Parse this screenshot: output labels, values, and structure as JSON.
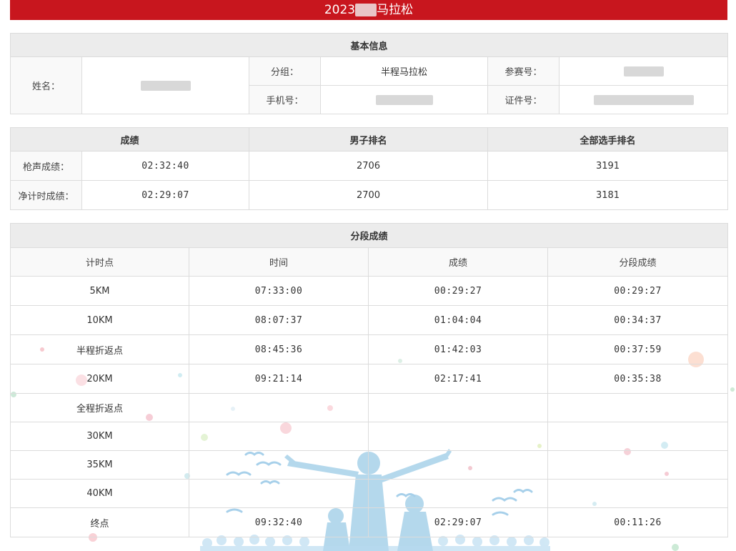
{
  "header": {
    "title_prefix": "2023",
    "title_suffix": "马拉松"
  },
  "basic": {
    "section_title": "基本信息",
    "name_label": "姓名：",
    "group_label": "分组：",
    "group_value": "半程马拉松",
    "bib_label": "参赛号：",
    "phone_label": "手机号：",
    "id_label": "证件号："
  },
  "results": {
    "headers": [
      "成绩",
      "男子排名",
      "全部选手排名"
    ],
    "gun": {
      "label": "枪声成绩：",
      "time": "02:32:40",
      "male_rank": "2706",
      "overall_rank": "3191"
    },
    "net": {
      "label": "净计时成绩：",
      "time": "02:29:07",
      "male_rank": "2700",
      "overall_rank": "3181"
    }
  },
  "splits": {
    "section_title": "分段成绩",
    "headers": [
      "计时点",
      "时间",
      "成绩",
      "分段成绩"
    ],
    "rows": [
      {
        "point": "5KM",
        "time": "07:33:00",
        "result": "00:29:27",
        "split": "00:29:27"
      },
      {
        "point": "10KM",
        "time": "08:07:37",
        "result": "01:04:04",
        "split": "00:34:37"
      },
      {
        "point": "半程折返点",
        "time": "08:45:36",
        "result": "01:42:03",
        "split": "00:37:59"
      },
      {
        "point": "20KM",
        "time": "09:21:14",
        "result": "02:17:41",
        "split": "00:35:38"
      },
      {
        "point": "全程折返点",
        "time": "",
        "result": "",
        "split": ""
      },
      {
        "point": "30KM",
        "time": "",
        "result": "",
        "split": ""
      },
      {
        "point": "35KM",
        "time": "",
        "result": "",
        "split": ""
      },
      {
        "point": "40KM",
        "time": "",
        "result": "",
        "split": ""
      },
      {
        "point": "终点",
        "time": "09:32:40",
        "result": "02:29:07",
        "split": "00:11:26"
      }
    ]
  },
  "colors": {
    "brand_red": "#c8161e",
    "header_gray": "#ececec",
    "border": "#dcdcdc",
    "art_blue": "#8fc6e6"
  }
}
